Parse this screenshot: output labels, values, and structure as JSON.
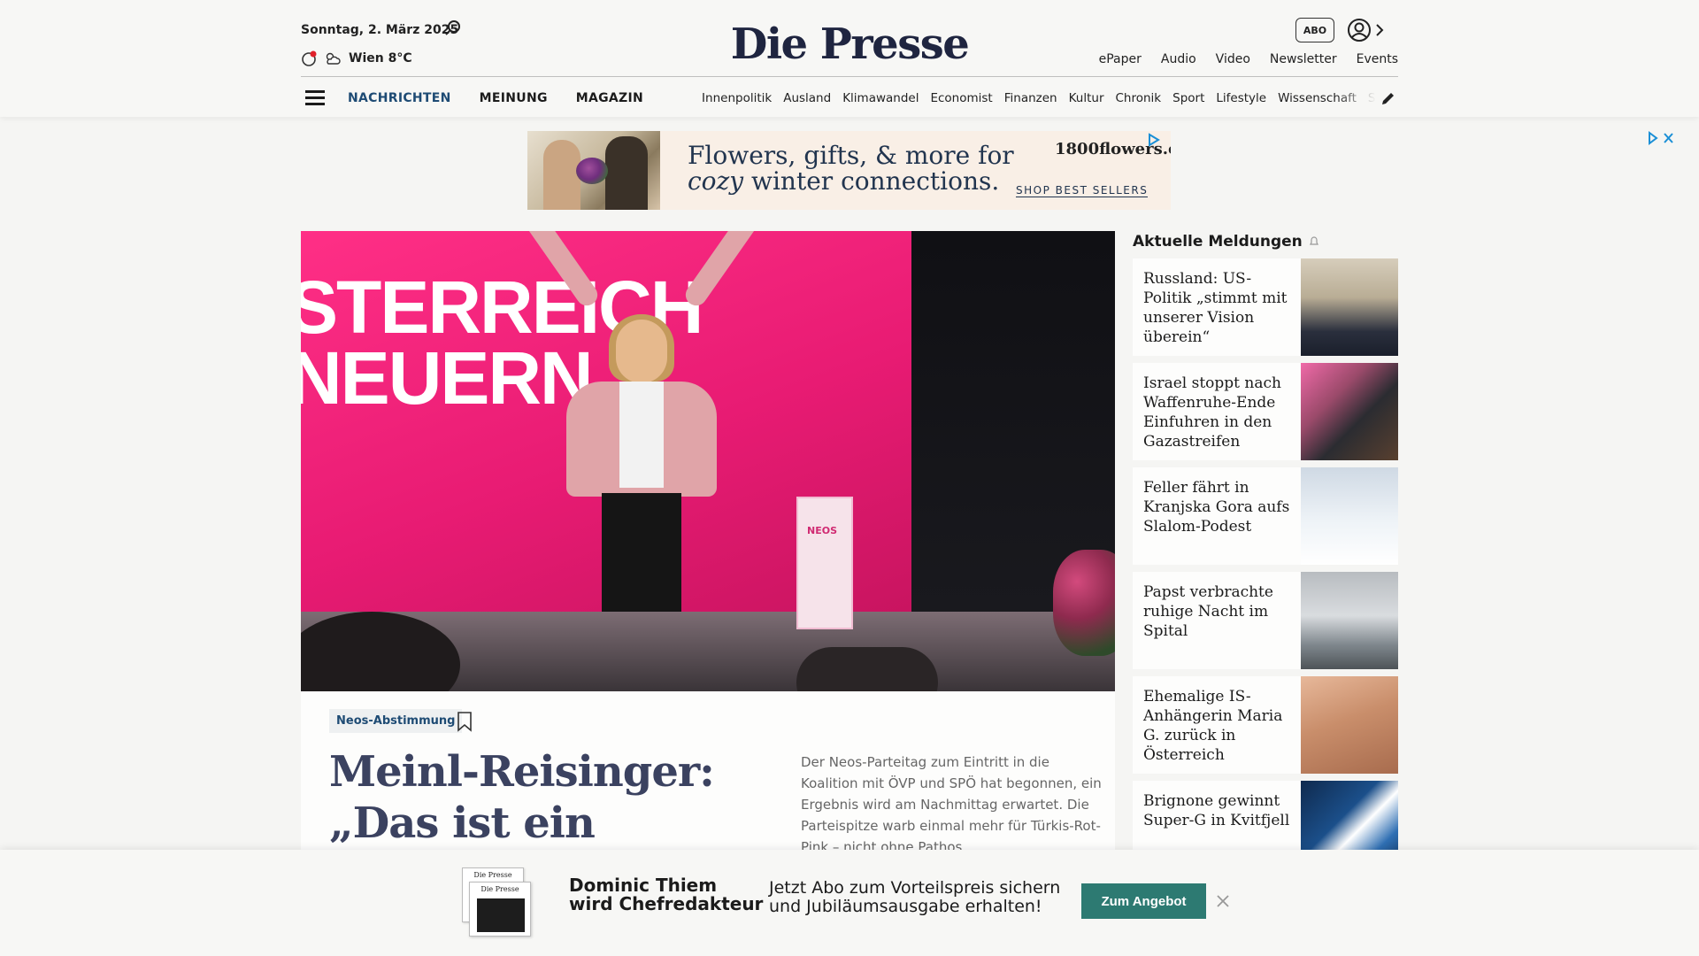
{
  "header": {
    "date": "Sonntag, 2. März 2025",
    "weather": "Wien 8°C",
    "logo": "Die Presse",
    "abo_label": "ABO",
    "top_links": [
      "ePaper",
      "Audio",
      "Video",
      "Newsletter",
      "Events"
    ],
    "main_nav": [
      "NACHRICHTEN",
      "MEINUNG",
      "MAGAZIN"
    ],
    "sub_nav": [
      "Innenpolitik",
      "Ausland",
      "Klimawandel",
      "Economist",
      "Finanzen",
      "Kultur",
      "Chronik",
      "Sport",
      "Lifestyle",
      "Wissenschaft",
      "Spectrum"
    ]
  },
  "ad": {
    "line1": "Flowers, gifts, & more for",
    "line2_italic": "cozy",
    "line2_rest": " winter connections.",
    "brand": "1800flowers.com",
    "cta": "SHOP BEST SELLERS"
  },
  "hero": {
    "slogan_line1": "STERREICH",
    "slogan_line2": "NEUERN.",
    "podium": "NEOS"
  },
  "article": {
    "tag": "Neos-Abstimmung",
    "headline": "Meinl-Reisinger: „Das ist ein historischer Tag für",
    "teaser": "Der Neos-Parteitag zum Eintritt in die Koalition mit ÖVP und SPÖ hat begonnen, ein Ergebnis wird am Nachmittag erwartet. Die Parteispitze warb einmal mehr für Türkis-Rot-Pink – nicht ohne Pathos."
  },
  "sidebar": {
    "title": "Aktuelle Meldungen",
    "items": [
      {
        "title": "Russland: US-Politik „stimmt mit unserer Vision überein“"
      },
      {
        "title": "Israel stoppt nach Waffenruhe-Ende Einfuhren in den Gazastreifen"
      },
      {
        "title": "Feller fährt in Kranjska Gora aufs Slalom-Podest"
      },
      {
        "title": "Papst verbrachte ruhige Nacht im Spital"
      },
      {
        "title": "Ehemalige IS-Anhängerin Maria G. zurück in Österreich"
      },
      {
        "title": "Brignone gewinnt Super-G in Kvitfjell"
      }
    ]
  },
  "promo": {
    "paper_logo": "Die Presse",
    "name_line1": "Dominic Thiem",
    "name_line2": "wird Chefredakteur",
    "offer_line1": "Jetzt Abo zum Vorteilspreis sichern",
    "offer_line2": "und Jubiläumsausgabe erhalten!",
    "button": "Zum Angebot"
  },
  "colors": {
    "nav_active": "#1e4b74",
    "headline": "#3b4260",
    "promo_button": "#2d7a72",
    "hero_pink": "#e81b73"
  }
}
